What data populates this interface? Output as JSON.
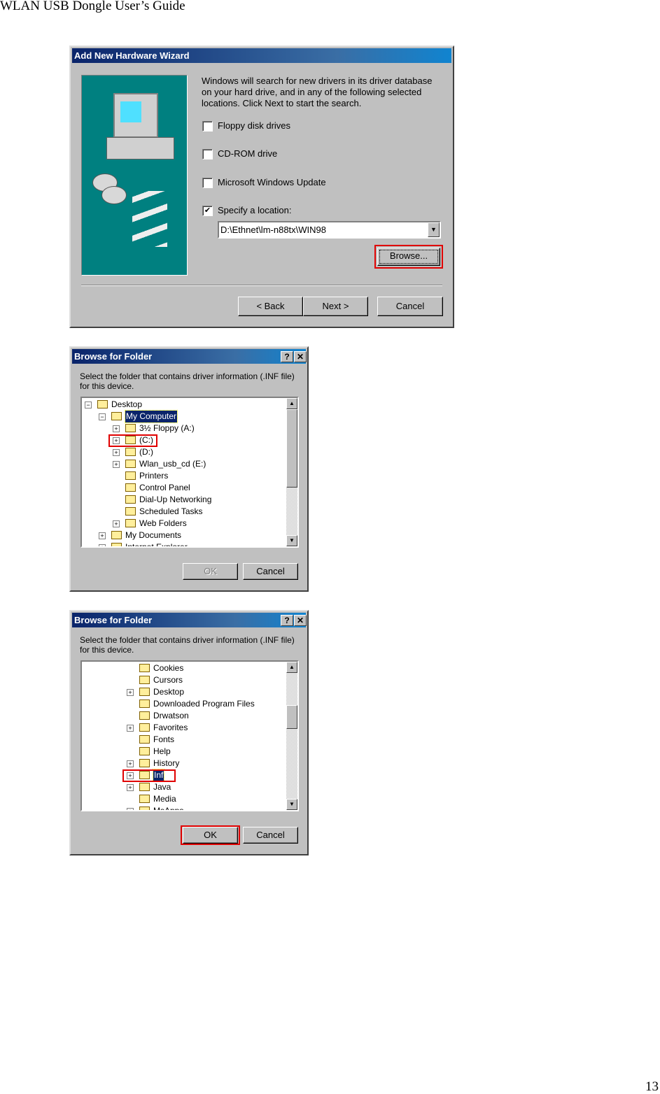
{
  "document": {
    "header": "WLAN USB Dongle User’s Guide",
    "page_number": "13"
  },
  "wizard": {
    "title": "Add New Hardware Wizard",
    "description": "Windows will search for new drivers in its driver database on your hard drive, and in any of the following selected locations. Click Next to start the search.",
    "options": [
      {
        "label": "Floppy disk drives",
        "checked": false
      },
      {
        "label": "CD-ROM drive",
        "checked": false
      },
      {
        "label": "Microsoft Windows Update",
        "checked": false
      },
      {
        "label": "Specify a location:",
        "checked": true
      }
    ],
    "location_value": "D:\\Ethnet\\lm-n88tx\\WIN98",
    "browse_label": "Browse...",
    "back_label": "< Back",
    "next_label": "Next >",
    "cancel_label": "Cancel"
  },
  "browse1": {
    "title": "Browse for Folder",
    "help": "?",
    "close": "✕",
    "description": "Select the folder that contains driver information (.INF file) for this device.",
    "tree": [
      {
        "label": "Desktop",
        "level": 0,
        "exp": "−"
      },
      {
        "label": "My Computer",
        "level": 1,
        "exp": "−",
        "selected": true
      },
      {
        "label": "3½ Floppy (A:)",
        "level": 2,
        "exp": "+"
      },
      {
        "label": " (C:)",
        "level": 2,
        "exp": "+",
        "highlight": true
      },
      {
        "label": " (D:)",
        "level": 2,
        "exp": "+"
      },
      {
        "label": "Wlan_usb_cd (E:)",
        "level": 2,
        "exp": "+"
      },
      {
        "label": "Printers",
        "level": 2
      },
      {
        "label": "Control Panel",
        "level": 2
      },
      {
        "label": "Dial-Up Networking",
        "level": 2
      },
      {
        "label": "Scheduled Tasks",
        "level": 2
      },
      {
        "label": "Web Folders",
        "level": 2,
        "exp": "+"
      },
      {
        "label": "My Documents",
        "level": 1,
        "exp": "+"
      },
      {
        "label": "Internet Explorer",
        "level": 1,
        "exp": "+"
      }
    ],
    "ok_label": "OK",
    "cancel_label": "Cancel",
    "ok_disabled": true
  },
  "browse2": {
    "title": "Browse for Folder",
    "help": "?",
    "close": "✕",
    "description": "Select the folder that contains driver information (.INF file) for this device.",
    "tree": [
      {
        "label": "Cookies",
        "level": 3
      },
      {
        "label": "Cursors",
        "level": 3
      },
      {
        "label": "Desktop",
        "level": 3,
        "exp": "+"
      },
      {
        "label": "Downloaded Program Files",
        "level": 3
      },
      {
        "label": "Drwatson",
        "level": 3
      },
      {
        "label": "Favorites",
        "level": 3,
        "exp": "+"
      },
      {
        "label": "Fonts",
        "level": 3
      },
      {
        "label": "Help",
        "level": 3
      },
      {
        "label": "History",
        "level": 3,
        "exp": "+"
      },
      {
        "label": "Inf",
        "level": 3,
        "exp": "+",
        "selected": true,
        "highlight": true
      },
      {
        "label": "Java",
        "level": 3,
        "exp": "+"
      },
      {
        "label": "Media",
        "level": 3
      },
      {
        "label": "MsApps",
        "level": 3,
        "exp": "+"
      }
    ],
    "ok_label": "OK",
    "cancel_label": "Cancel",
    "ok_disabled": false
  },
  "colors": {
    "highlight_box": "#e00000",
    "title_bar": "#0a246a",
    "dialog_bg": "#c0c0c0",
    "wizard_art_bg": "#008080"
  }
}
